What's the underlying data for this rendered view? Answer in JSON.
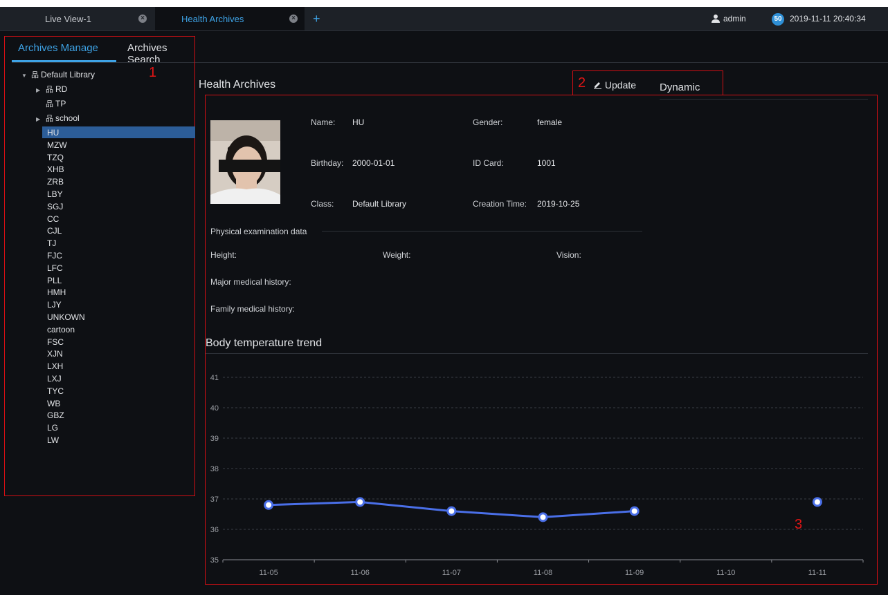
{
  "tabs": [
    {
      "label": "Live View-1",
      "active": false
    },
    {
      "label": "Health Archives",
      "active": true
    }
  ],
  "tab_add": "+",
  "user": {
    "name": "admin",
    "badge": "50",
    "datetime": "2019-11-11 20:40:34"
  },
  "left_tabs": {
    "manage": "Archives Manage",
    "search": "Archives Search"
  },
  "tree": {
    "root": "Default Library",
    "groups": [
      "RD",
      "TP",
      "school"
    ],
    "items": [
      "HU",
      "MZW",
      "TZQ",
      "XHB",
      "ZRB",
      "LBY",
      "SGJ",
      "CC",
      "CJL",
      "TJ",
      "FJC",
      "LFC",
      "PLL",
      "HMH",
      "LJY",
      "UNKOWN",
      "cartoon",
      "FSC",
      "XJN",
      "LXH",
      "LXJ",
      "TYC",
      "WB",
      "GBZ",
      "LG",
      "LW"
    ],
    "selected": "HU"
  },
  "markers": [
    "1",
    "2",
    "3"
  ],
  "panel": {
    "title": "Health Archives",
    "update_label": "Update",
    "dynamic_label": "Dynamic"
  },
  "profile": {
    "name_label": "Name:",
    "name": "HU",
    "gender_label": "Gender:",
    "gender": "female",
    "birthday_label": "Birthday:",
    "birthday": "2000-01-01",
    "id_label": "ID Card:",
    "id": "1001",
    "class_label": "Class:",
    "class": "Default Library",
    "created_label": "Creation Time:",
    "created": "2019-10-25"
  },
  "exam": {
    "section": "Physical examination data",
    "height_label": "Height:",
    "weight_label": "Weight:",
    "vision_label": "Vision:",
    "major_label": "Major medical history:",
    "family_label": "Family medical history:"
  },
  "chart_title": "Body temperature trend",
  "colors": {
    "accent": "#3ea3e6",
    "line": "#4a6fe8",
    "highlight": "#2c5d98",
    "annotation": "#d40f14"
  },
  "chart_data": {
    "type": "line",
    "title": "Body temperature trend",
    "categories": [
      "11-05",
      "11-06",
      "11-07",
      "11-08",
      "11-09",
      "11-10",
      "11-11"
    ],
    "series": [
      {
        "values": [
          36.8,
          36.9,
          36.6,
          36.4,
          36.6,
          null,
          36.9
        ]
      }
    ],
    "yticks": [
      35,
      36,
      37,
      38,
      39,
      40,
      41
    ],
    "ylim": [
      35,
      41
    ],
    "grid": true
  }
}
